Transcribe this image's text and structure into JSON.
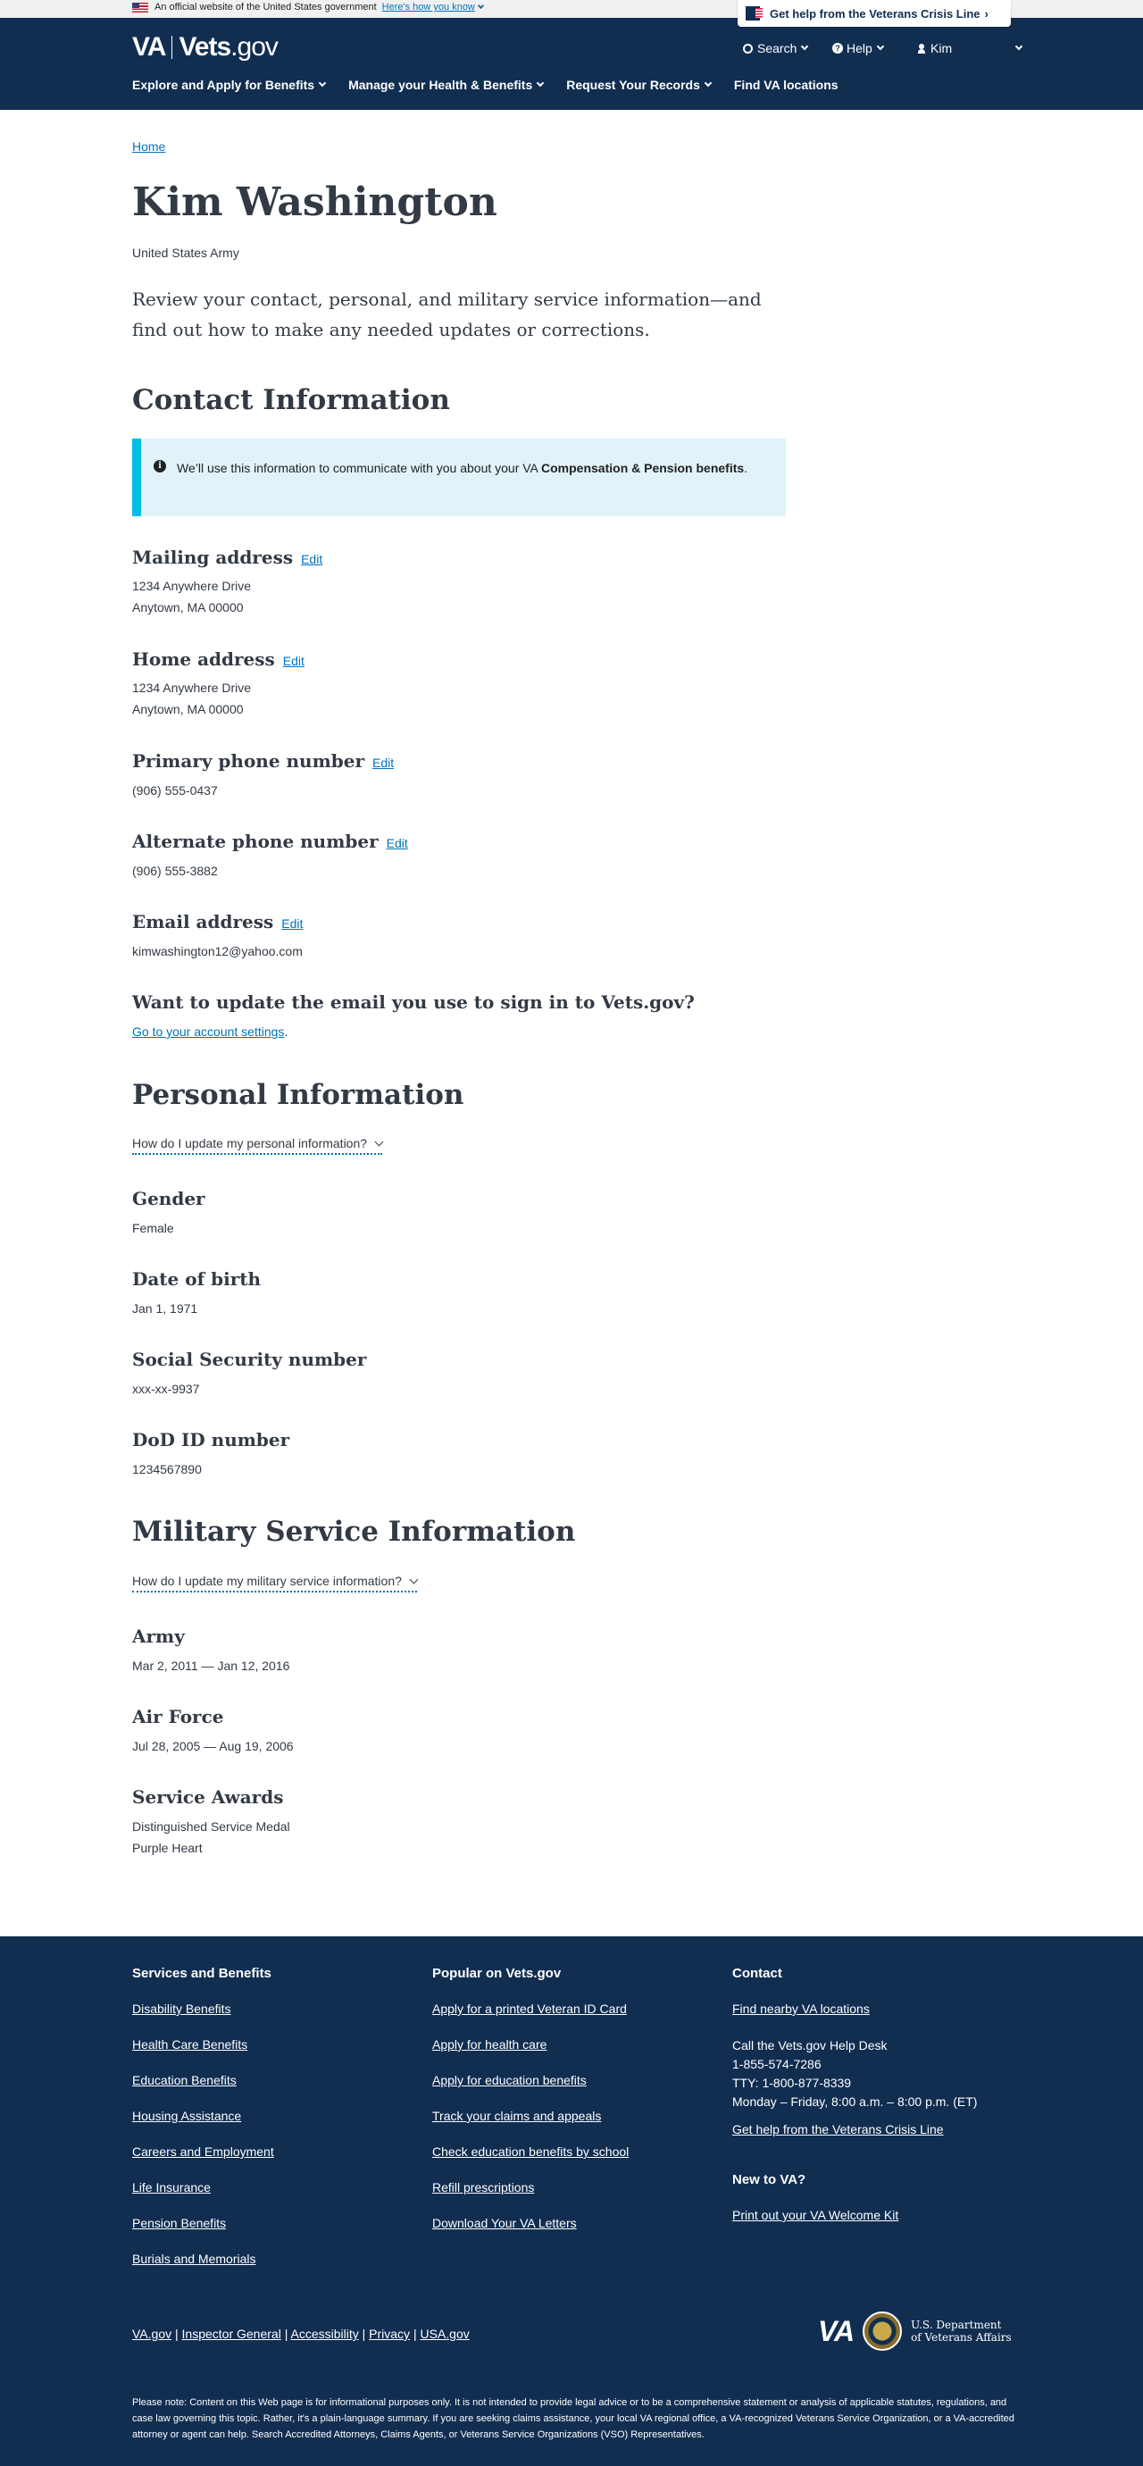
{
  "banner": {
    "official_text": "An official website of the United States government",
    "how_link": "Here's how you know",
    "crisis_line": "Get help from the Veterans Crisis Line"
  },
  "header": {
    "logo_va": "VA",
    "logo_site": "Vets",
    "logo_tld": ".gov",
    "search": "Search",
    "help": "Help",
    "user": "Kim",
    "nav": [
      "Explore and Apply for Benefits",
      "Manage your Health & Benefits",
      "Request Your Records",
      "Find VA locations"
    ]
  },
  "breadcrumb": "Home",
  "profile": {
    "name": "Kim Washington",
    "branch": "United States Army",
    "intro": "Review your contact, personal, and military service information—and find out how to make any needed updates or corrections."
  },
  "contact": {
    "heading": "Contact Information",
    "alert_prefix": "We’ll use this information to communicate with you about your VA ",
    "alert_bold": "Compensation & Pension benefits",
    "alert_suffix": ".",
    "edit_label": "Edit",
    "mailing_label": "Mailing address",
    "mailing_line1": "1234 Anywhere Drive",
    "mailing_line2": "Anytown, MA 00000",
    "home_label": "Home address",
    "home_line1": "1234 Anywhere Drive",
    "home_line2": "Anytown, MA 00000",
    "primary_label": "Primary phone number",
    "primary_value": "(906) 555-0437",
    "alternate_label": "Alternate phone number",
    "alternate_value": "(906) 555-3882",
    "email_label": "Email address",
    "email_value": "kimwashington12@yahoo.com",
    "signin_heading": "Want to update the email you use to sign in to Vets.gov?",
    "signin_link": "Go to your account settings",
    "signin_period": "."
  },
  "personal": {
    "heading": "Personal Information",
    "accordion": "How do I update my personal information?",
    "gender_label": "Gender",
    "gender_value": "Female",
    "dob_label": "Date of birth",
    "dob_value": "Jan 1, 1971",
    "ssn_label": "Social Security number",
    "ssn_value": "xxx-xx-9937",
    "dod_label": "DoD ID number",
    "dod_value": "1234567890"
  },
  "military": {
    "heading": "Military Service Information",
    "accordion": "How do I update my military service information?",
    "army_label": "Army",
    "army_value": "Mar 2, 2011 — Jan 12, 2016",
    "airforce_label": "Air Force",
    "airforce_value": "Jul 28, 2005 — Aug 19, 2006",
    "awards_label": "Service Awards",
    "awards": [
      "Distinguished Service Medal",
      "Purple Heart"
    ]
  },
  "footer": {
    "services_heading": "Services and Benefits",
    "services": [
      "Disability Benefits",
      "Health Care Benefits",
      "Education Benefits",
      "Housing Assistance",
      "Careers and Employment",
      "Life Insurance",
      "Pension Benefits",
      "Burials and Memorials"
    ],
    "popular_heading": "Popular on Vets.gov",
    "popular": [
      "Apply for a printed Veteran ID Card",
      "Apply for health care",
      "Apply for education benefits",
      "Track your claims and appeals",
      "Check education benefits by school",
      "Refill prescriptions",
      "Download Your VA Letters"
    ],
    "contact_heading": "Contact",
    "find_locations": "Find nearby VA locations",
    "call_text": "Call the Vets.gov Help Desk",
    "phone": "1-855-574-7286",
    "tty_label": "TTY: ",
    "tty": "1-800-877-8339",
    "hours": "Monday – Friday, 8:00 a.m. – 8:00 p.m. (ET)",
    "crisis_link": "Get help from the Veterans Crisis Line",
    "new_heading": "New to VA?",
    "welcome_kit": "Print out your VA Welcome Kit",
    "legal": [
      "VA.gov",
      "Inspector General",
      "Accessibility",
      "Privacy",
      "USA.gov"
    ],
    "legal_sep": "|",
    "va_logo": "VA",
    "dept_line1": "U.S. Department",
    "dept_line2": "of Veterans Affairs",
    "disclaimer": "Please note: Content on this Web page is for informational purposes only. It is not intended to provide legal advice or to be a comprehensive statement or analysis of applicable statutes, regulations, and case law governing this topic. Rather, it's a plain-language summary. If you are seeking claims assistance, your local VA regional office, a VA-recognized Veterans Service Organization, or a VA-accredited attorney or agent can help. Search Accredited Attorneys, Claims Agents, or Veterans Service Organizations (VSO) Representatives."
  }
}
